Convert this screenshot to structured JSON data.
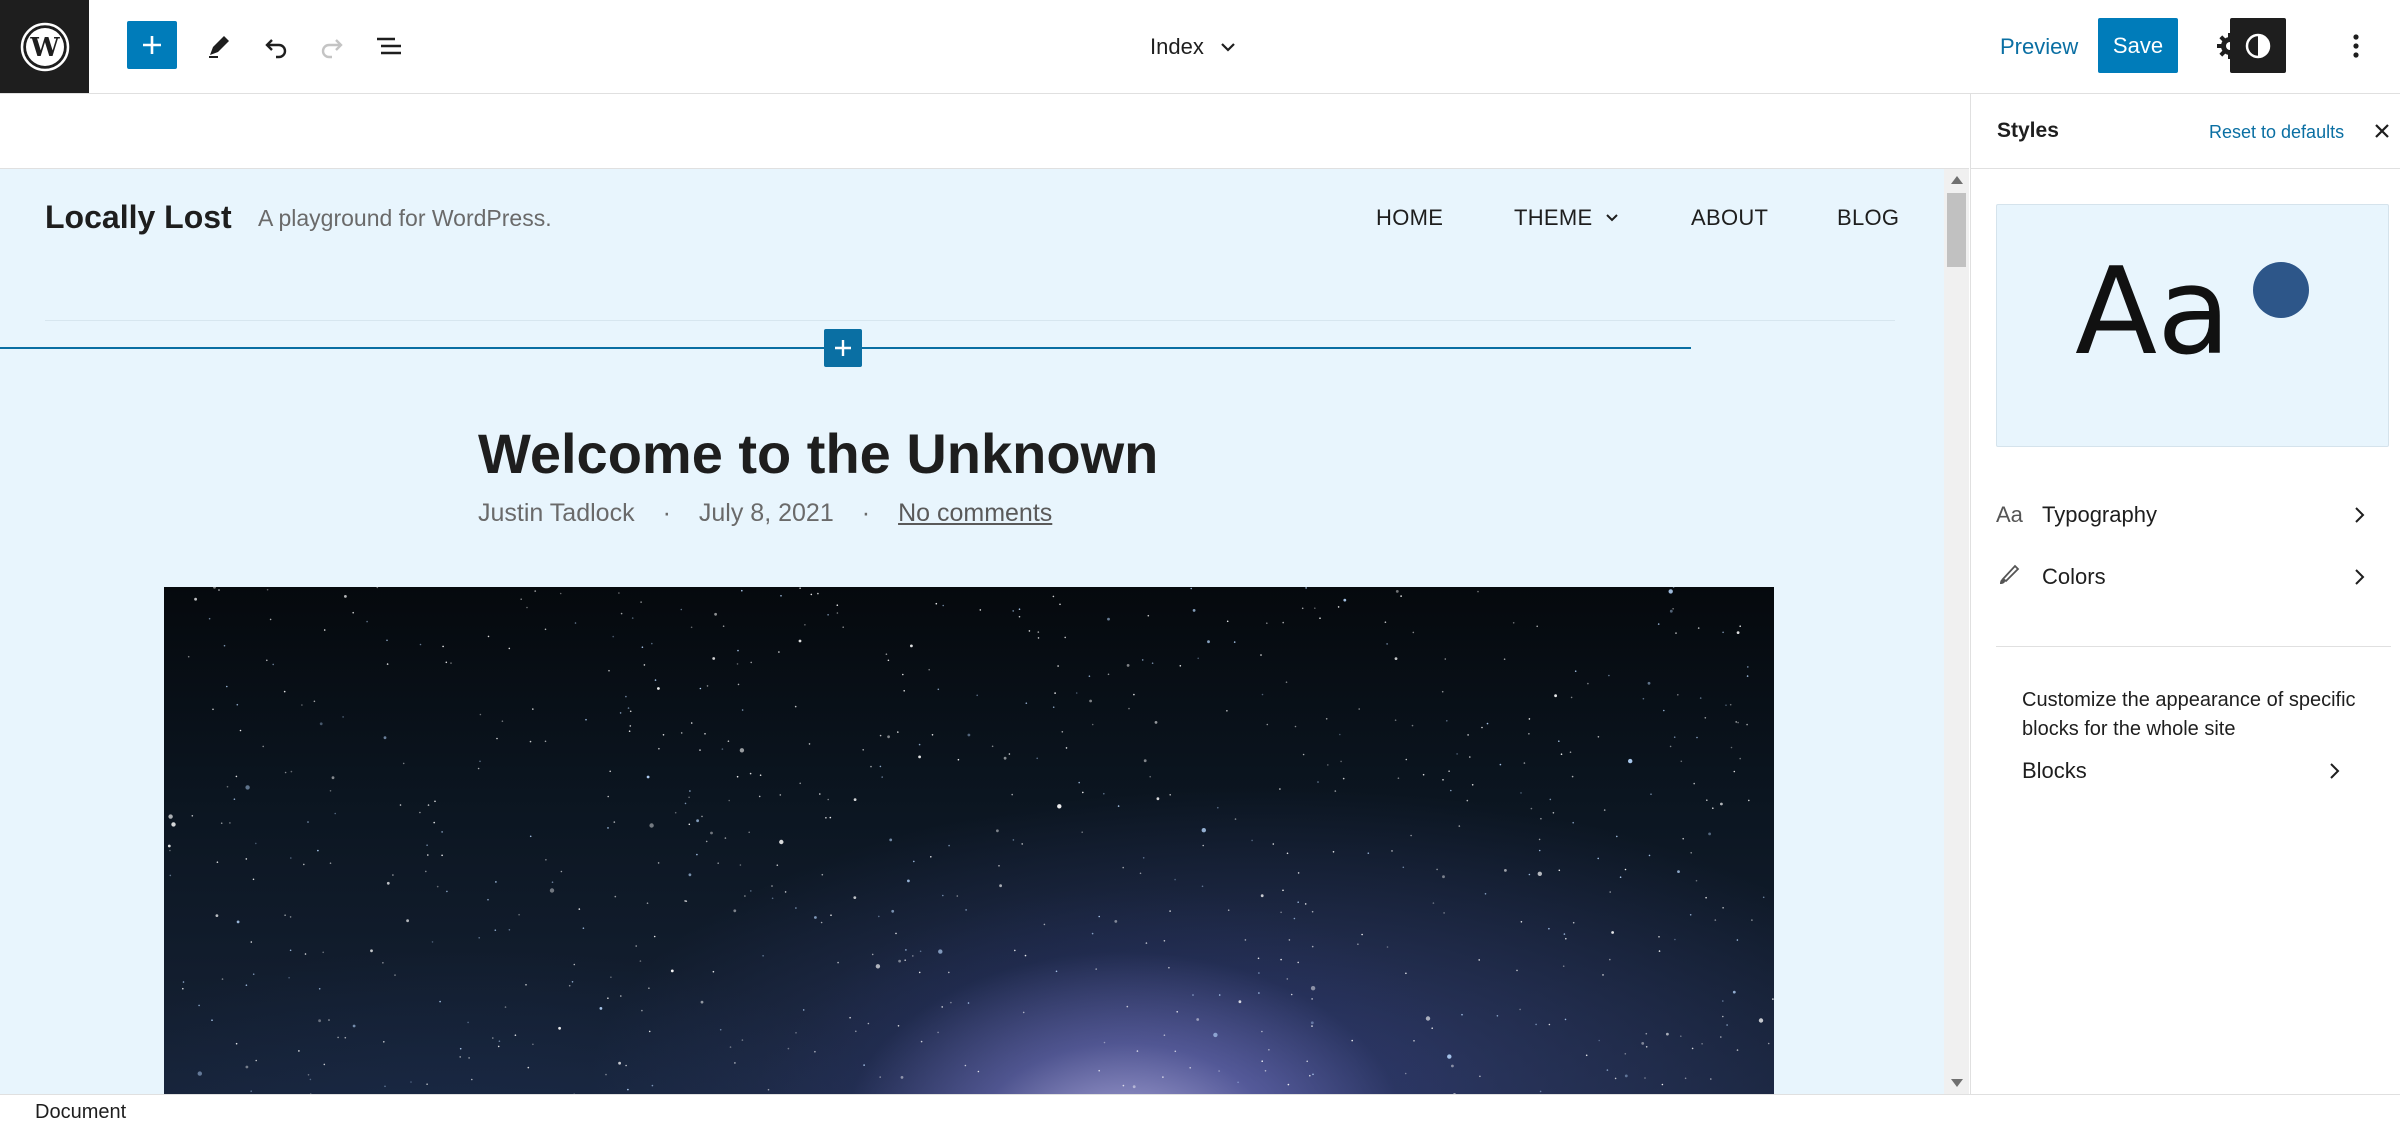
{
  "toolbar": {
    "document_title": "Index",
    "preview_label": "Preview",
    "save_label": "Save"
  },
  "site": {
    "title": "Locally Lost",
    "tagline": "A playground for WordPress.",
    "nav": [
      "HOME",
      "THEME",
      "ABOUT",
      "BLOG"
    ]
  },
  "post": {
    "title": "Welcome to the Unknown",
    "author": "Justin Tadlock",
    "separator": "·",
    "date": "July 8, 2021",
    "comments": "No comments"
  },
  "sidebar": {
    "title": "Styles",
    "reset_label": "Reset to defaults",
    "preview_text": "Aa",
    "preview_color": "#2d5689",
    "typography_icon": "Aa",
    "typography_label": "Typography",
    "colors_label": "Colors",
    "blocks_description": "Customize the appearance of specific blocks for the whole site",
    "blocks_label": "Blocks"
  },
  "footer": {
    "breadcrumb": "Document"
  },
  "colors": {
    "accent": "#007cba",
    "canvas_background": "#e8f5fd",
    "dark": "#1e1e1e"
  }
}
